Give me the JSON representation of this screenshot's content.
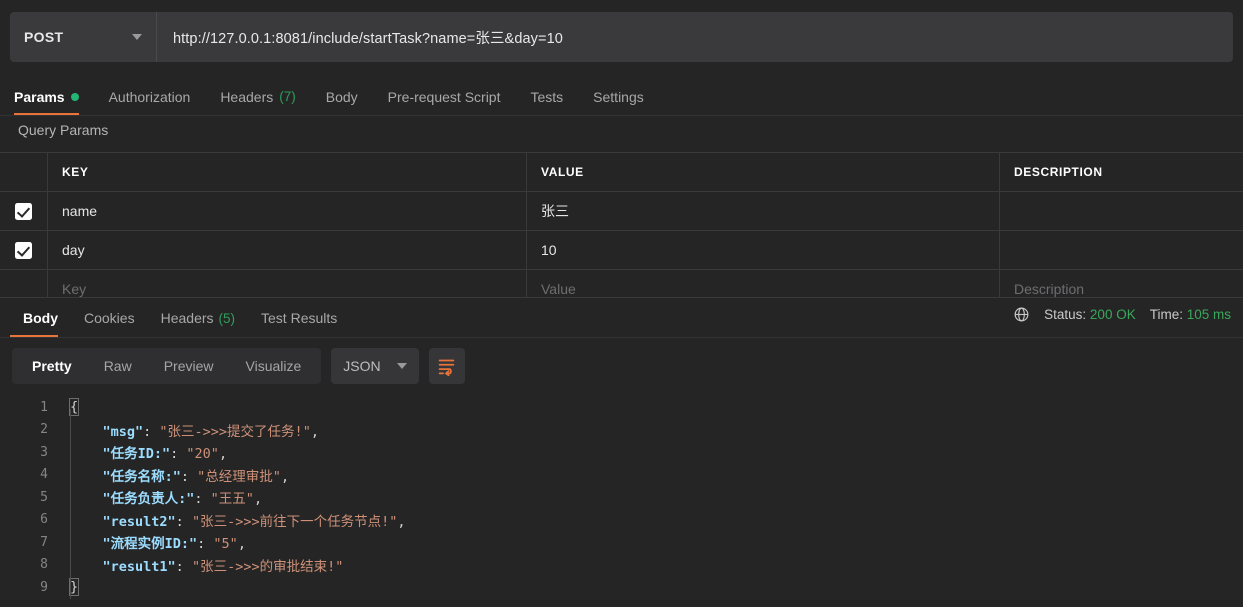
{
  "request": {
    "method": "POST",
    "method_icon": "chevron-down-icon",
    "url": "http://127.0.0.1:8081/include/startTask?name=张三&day=10",
    "url_placeholder": "Enter request URL",
    "tabs": [
      {
        "label": "Params",
        "badge": "",
        "dot": true,
        "active": true
      },
      {
        "label": "Authorization",
        "badge": "",
        "dot": false,
        "active": false
      },
      {
        "label": "Headers",
        "badge": "(7)",
        "dot": false,
        "active": false
      },
      {
        "label": "Body",
        "badge": "",
        "dot": false,
        "active": false
      },
      {
        "label": "Pre-request Script",
        "badge": "",
        "dot": false,
        "active": false
      },
      {
        "label": "Tests",
        "badge": "",
        "dot": false,
        "active": false
      },
      {
        "label": "Settings",
        "badge": "",
        "dot": false,
        "active": false
      }
    ]
  },
  "query_params": {
    "section_title": "Query Params",
    "columns": [
      "KEY",
      "VALUE",
      "DESCRIPTION"
    ],
    "rows": [
      {
        "checked": true,
        "key": "name",
        "value": "张三",
        "description": ""
      },
      {
        "checked": true,
        "key": "day",
        "value": "10",
        "description": ""
      }
    ],
    "empty_row": {
      "key": "Key",
      "value": "Value",
      "description": "Description"
    }
  },
  "response": {
    "tabs": [
      {
        "label": "Body",
        "badge": "",
        "active": true
      },
      {
        "label": "Cookies",
        "badge": "",
        "active": false
      },
      {
        "label": "Headers",
        "badge": "(5)",
        "active": false
      },
      {
        "label": "Test Results",
        "badge": "",
        "active": false
      }
    ],
    "globe_icon": "globe-icon",
    "status_label": "Status:",
    "status_value": "200 OK",
    "time_label": "Time:",
    "time_value": "105 ms",
    "view_modes": [
      {
        "label": "Pretty",
        "active": true
      },
      {
        "label": "Raw",
        "active": false
      },
      {
        "label": "Preview",
        "active": false
      },
      {
        "label": "Visualize",
        "active": false
      }
    ],
    "format": "JSON",
    "format_icon": "chevron-down-icon",
    "wrap_icon": "word-wrap-icon",
    "body_lines": [
      {
        "no": "1",
        "indent": 0,
        "tokens": [
          {
            "t": "brace",
            "v": "{"
          }
        ]
      },
      {
        "no": "2",
        "indent": 1,
        "tokens": [
          {
            "t": "key",
            "v": "\"msg\""
          },
          {
            "t": "pun",
            "v": ": "
          },
          {
            "t": "str",
            "v": "\"张三->>>提交了任务!\""
          },
          {
            "t": "pun",
            "v": ","
          }
        ]
      },
      {
        "no": "3",
        "indent": 1,
        "tokens": [
          {
            "t": "key",
            "v": "\"任务ID:\""
          },
          {
            "t": "pun",
            "v": ": "
          },
          {
            "t": "str",
            "v": "\"20\""
          },
          {
            "t": "pun",
            "v": ","
          }
        ]
      },
      {
        "no": "4",
        "indent": 1,
        "tokens": [
          {
            "t": "key",
            "v": "\"任务名称:\""
          },
          {
            "t": "pun",
            "v": ": "
          },
          {
            "t": "str",
            "v": "\"总经理审批\""
          },
          {
            "t": "pun",
            "v": ","
          }
        ]
      },
      {
        "no": "5",
        "indent": 1,
        "tokens": [
          {
            "t": "key",
            "v": "\"任务负责人:\""
          },
          {
            "t": "pun",
            "v": ": "
          },
          {
            "t": "str",
            "v": "\"王五\""
          },
          {
            "t": "pun",
            "v": ","
          }
        ]
      },
      {
        "no": "6",
        "indent": 1,
        "tokens": [
          {
            "t": "key",
            "v": "\"result2\""
          },
          {
            "t": "pun",
            "v": ": "
          },
          {
            "t": "str",
            "v": "\"张三->>>前往下一个任务节点!\""
          },
          {
            "t": "pun",
            "v": ","
          }
        ]
      },
      {
        "no": "7",
        "indent": 1,
        "tokens": [
          {
            "t": "key",
            "v": "\"流程实例ID:\""
          },
          {
            "t": "pun",
            "v": ": "
          },
          {
            "t": "str",
            "v": "\"5\""
          },
          {
            "t": "pun",
            "v": ","
          }
        ]
      },
      {
        "no": "8",
        "indent": 1,
        "tokens": [
          {
            "t": "key",
            "v": "\"result1\""
          },
          {
            "t": "pun",
            "v": ": "
          },
          {
            "t": "str",
            "v": "\"张三->>>的审批结束!\""
          }
        ]
      },
      {
        "no": "9",
        "indent": 0,
        "tokens": [
          {
            "t": "brace",
            "v": "}"
          }
        ]
      }
    ]
  },
  "colors": {
    "accent": "#e8743b",
    "success": "#2e9e5b",
    "dot": "#22b573",
    "background": "#252526",
    "panel": "#3a3a3c",
    "json_key": "#9cdcfe",
    "json_string": "#ce9178"
  }
}
